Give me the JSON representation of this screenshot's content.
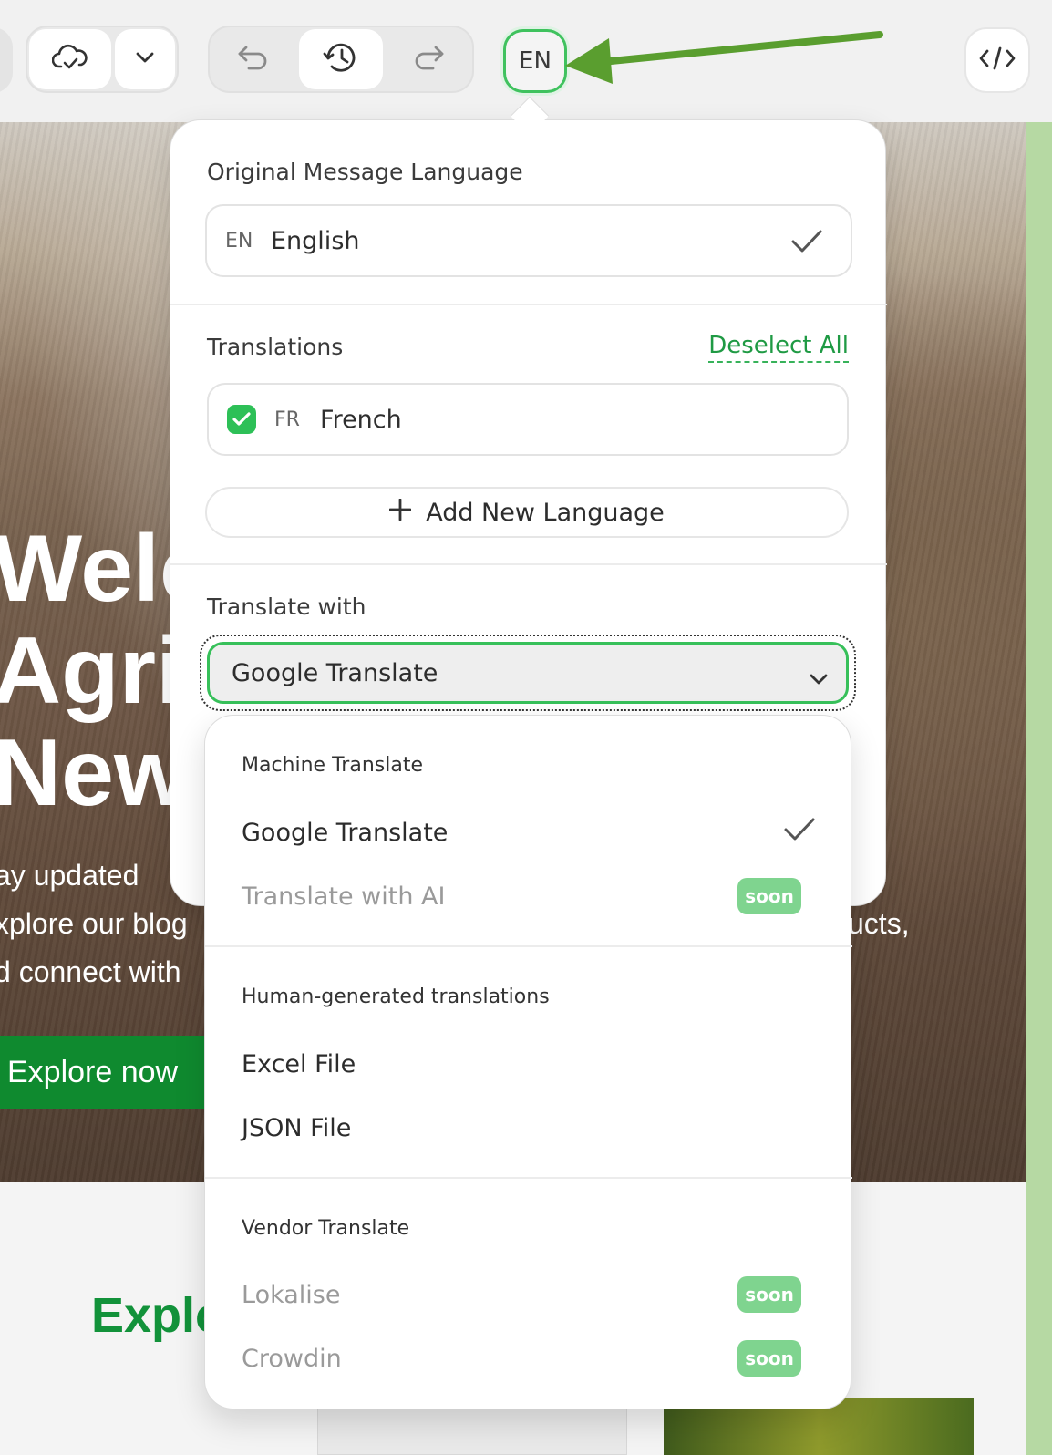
{
  "toolbar": {
    "language_button": "EN",
    "icons": [
      "cloud-sync-icon",
      "chevron-down-icon",
      "undo-icon",
      "history-icon",
      "redo-icon",
      "code-icon"
    ]
  },
  "background_page": {
    "hero_title_lines": [
      "Welc",
      "Agric",
      "New"
    ],
    "hero_text_lines": [
      "ay updated",
      "xplore our blog",
      "ucts,",
      "d connect with"
    ],
    "explore_button": "Explore now",
    "section_heading": "Explo"
  },
  "popover": {
    "original_label": "Original Message Language",
    "original": {
      "code": "EN",
      "name": "English"
    },
    "translations_label": "Translations",
    "deselect_all": "Deselect All",
    "translations": [
      {
        "code": "FR",
        "name": "French",
        "checked": true
      }
    ],
    "add_language": "Add New Language",
    "translate_with_label": "Translate with",
    "translate_with_value": "Google Translate"
  },
  "menu": {
    "groups": [
      {
        "title": "Machine Translate",
        "items": [
          {
            "label": "Google Translate",
            "selected": true,
            "disabled": false
          },
          {
            "label": "Translate with AI",
            "badge": "soon",
            "disabled": true
          }
        ]
      },
      {
        "title": "Human-generated translations",
        "items": [
          {
            "label": "Excel File",
            "disabled": false
          },
          {
            "label": "JSON File",
            "disabled": false
          }
        ]
      },
      {
        "title": "Vendor Translate",
        "items": [
          {
            "label": "Lokalise",
            "badge": "soon",
            "disabled": true
          },
          {
            "label": "Crowdin",
            "badge": "soon",
            "disabled": true
          }
        ]
      }
    ]
  },
  "colors": {
    "accent_green": "#37c05a",
    "badge_green": "#7fd48f",
    "explore_button_green": "#0f8a2f",
    "arrow_green": "#5a9e2f"
  }
}
